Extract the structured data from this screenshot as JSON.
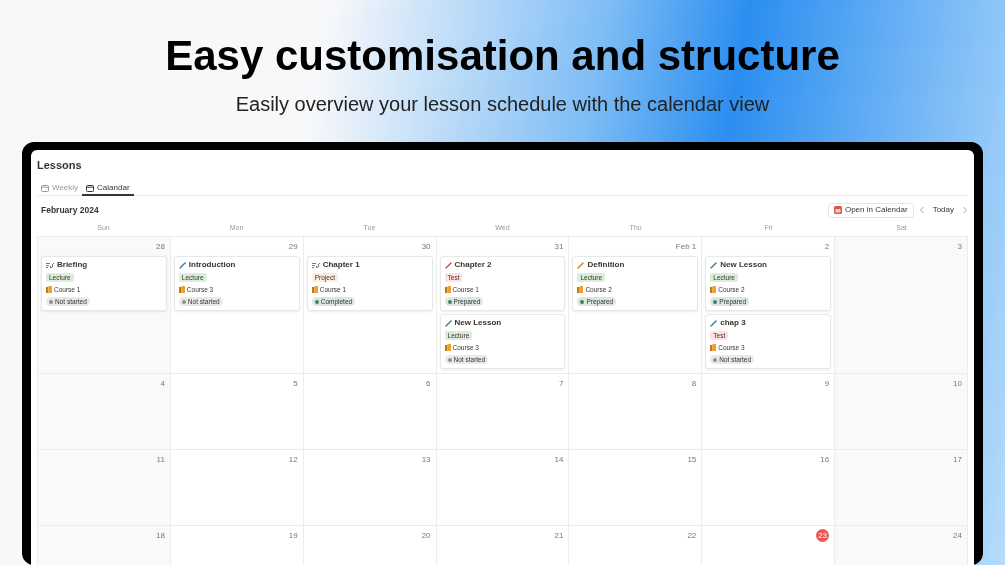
{
  "headline": {
    "title": "Easy customisation and structure",
    "subtitle": "Easily overview your lesson schedule with the calendar view"
  },
  "page_title": "Lessons",
  "tabs": [
    {
      "label": "Weekly",
      "selected": false
    },
    {
      "label": "Calandar",
      "selected": true
    }
  ],
  "month": "February 2024",
  "open_button": "Open in Calendar",
  "today_button": "Today",
  "weekdays": [
    "Sun",
    "Mon",
    "Tue",
    "Wed",
    "Thu",
    "Fri",
    "Sat"
  ],
  "weeks": [
    [
      {
        "date": "28",
        "today": false,
        "lessons": [
          {
            "title": "Briefing",
            "kind": "checklist",
            "color": "#787774",
            "type": {
              "label": "Lecture",
              "color": "#dbeddb"
            },
            "course": "Course 1",
            "status": {
              "label": "Not started",
              "color": "#91918e"
            }
          }
        ]
      },
      {
        "date": "29",
        "today": false,
        "lessons": [
          {
            "title": "Introduction",
            "kind": "pencil",
            "color": "#337ea9",
            "type": {
              "label": "Lecture",
              "color": "#dbeddb"
            },
            "course": "Course 3",
            "status": {
              "label": "Not started",
              "color": "#91918e"
            }
          }
        ]
      },
      {
        "date": "30",
        "today": false,
        "lessons": [
          {
            "title": "Chapter 1",
            "kind": "checklist",
            "color": "#787774",
            "type": {
              "label": "Project",
              "color": "#fbecdd"
            },
            "course": "Course 1",
            "status": {
              "label": "Completed",
              "color": "#448361"
            }
          }
        ]
      },
      {
        "date": "31",
        "today": false,
        "lessons": [
          {
            "title": "Chapter 2",
            "kind": "pencil",
            "color": "#d44c47",
            "type": {
              "label": "Test",
              "color": "#ffe2dd"
            },
            "course": "Course 1",
            "status": {
              "label": "Prepared",
              "color": "#448361"
            }
          },
          {
            "title": "New Lesson",
            "kind": "pencil",
            "color": "#448361",
            "type": {
              "label": "Lecture",
              "color": "#dbeddb"
            },
            "course": "Course 3",
            "status": {
              "label": "Not started",
              "color": "#91918e"
            }
          }
        ]
      },
      {
        "date": "Feb 1",
        "today": false,
        "lessons": [
          {
            "title": "Definition",
            "kind": "pencil",
            "color": "#d9730d",
            "type": {
              "label": "Lecture",
              "color": "#dbeddb"
            },
            "course": "Course 2",
            "status": {
              "label": "Prepared",
              "color": "#448361"
            }
          }
        ]
      },
      {
        "date": "2",
        "today": false,
        "lessons": [
          {
            "title": "New Lesson",
            "kind": "pencil",
            "color": "#448361",
            "type": {
              "label": "Lecture",
              "color": "#dbeddb"
            },
            "course": "Course 2",
            "status": {
              "label": "Prepared",
              "color": "#448361"
            }
          },
          {
            "title": "chap 3",
            "kind": "pencil",
            "color": "#337ea9",
            "type": {
              "label": "Test",
              "color": "#ffe2dd"
            },
            "course": "Course 3",
            "status": {
              "label": "Not started",
              "color": "#91918e"
            }
          }
        ]
      },
      {
        "date": "3",
        "today": false
      }
    ],
    [
      {
        "date": "4",
        "today": false
      },
      {
        "date": "5",
        "today": false
      },
      {
        "date": "6",
        "today": false
      },
      {
        "date": "7",
        "today": false
      },
      {
        "date": "8",
        "today": false
      },
      {
        "date": "9",
        "today": false
      },
      {
        "date": "10",
        "today": false
      }
    ],
    [
      {
        "date": "11",
        "today": false
      },
      {
        "date": "12",
        "today": false
      },
      {
        "date": "13",
        "today": false
      },
      {
        "date": "14",
        "today": false
      },
      {
        "date": "15",
        "today": false
      },
      {
        "date": "16",
        "today": false
      },
      {
        "date": "17",
        "today": false
      }
    ],
    [
      {
        "date": "18",
        "today": false
      },
      {
        "date": "19",
        "today": false
      },
      {
        "date": "20",
        "today": false
      },
      {
        "date": "21",
        "today": false
      },
      {
        "date": "22",
        "today": false
      },
      {
        "date": "23",
        "today": true
      },
      {
        "date": "24",
        "today": false
      }
    ]
  ]
}
